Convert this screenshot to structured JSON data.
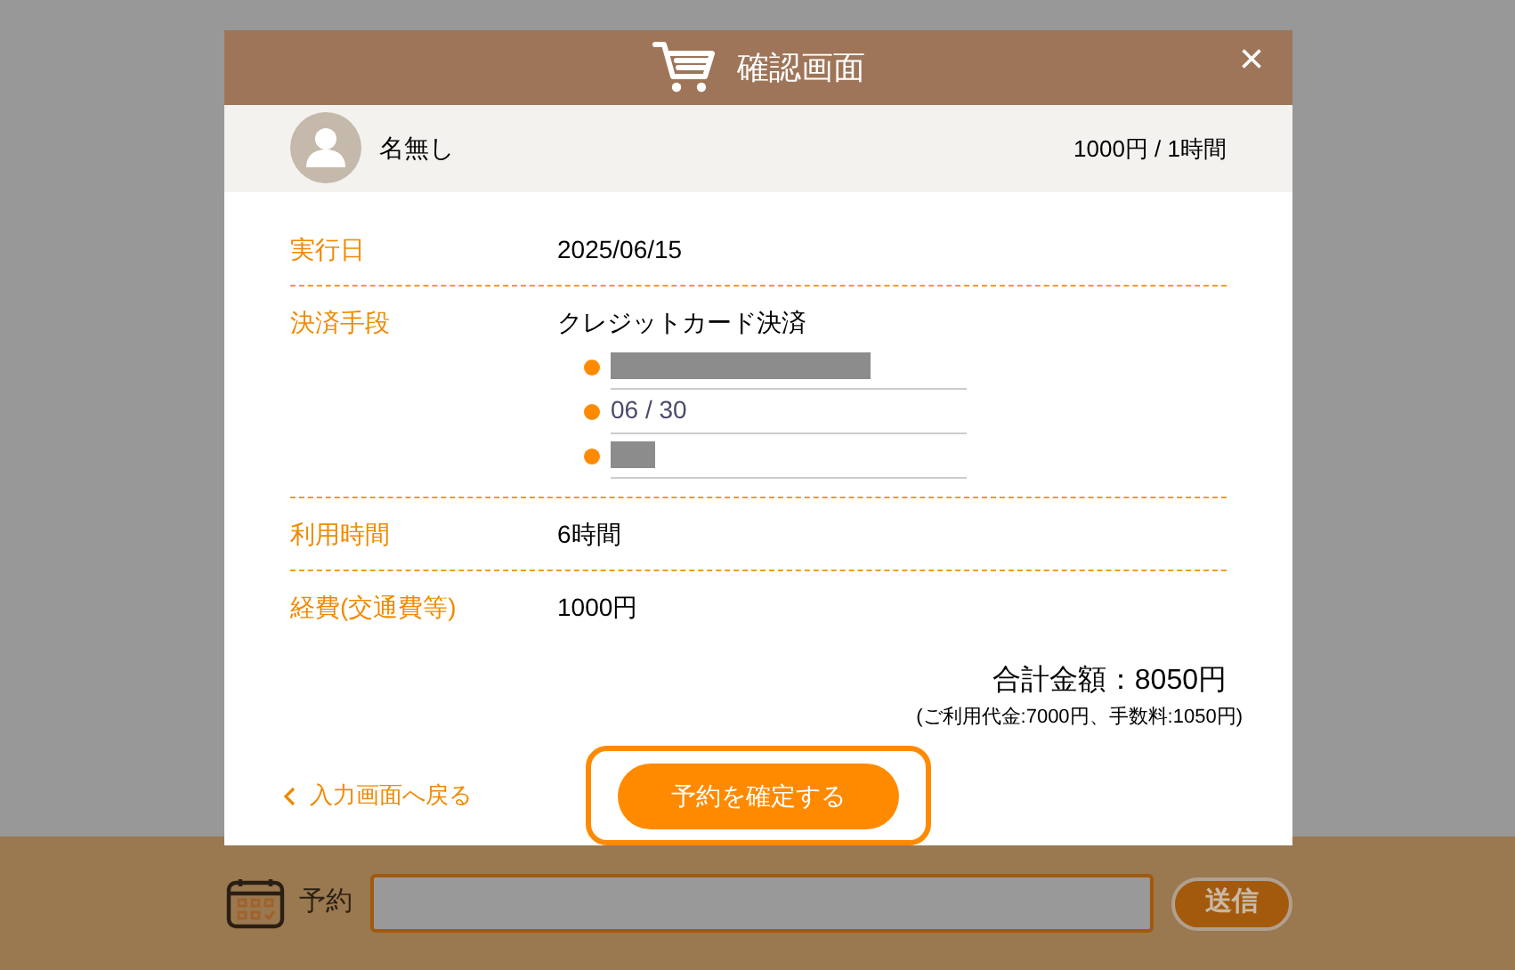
{
  "dialog": {
    "title": "確認画面",
    "close": "×",
    "user": {
      "name": "名無し",
      "rate": "1000円 / 1時間"
    },
    "rows": [
      {
        "label": "実行日",
        "value": "2025/06/15"
      },
      {
        "label": "決済手段",
        "value": "クレジットカード決済",
        "card_fields": [
          {
            "kind": "longmask"
          },
          {
            "kind": "text",
            "value": "06 / 30"
          },
          {
            "kind": "shortmask"
          }
        ]
      },
      {
        "label": "利用時間",
        "value": "6時間"
      },
      {
        "label": "経費(交通費等)",
        "value": "1000円"
      }
    ],
    "total": "合計金額：8050円",
    "breakdown": "(ご利用代金:7000円、手数料:1050円)",
    "back_link": "入力画面へ戻る",
    "confirm_button": "予約を確定する"
  },
  "bottom_bar": {
    "label": "予約",
    "send_button": "送信"
  }
}
